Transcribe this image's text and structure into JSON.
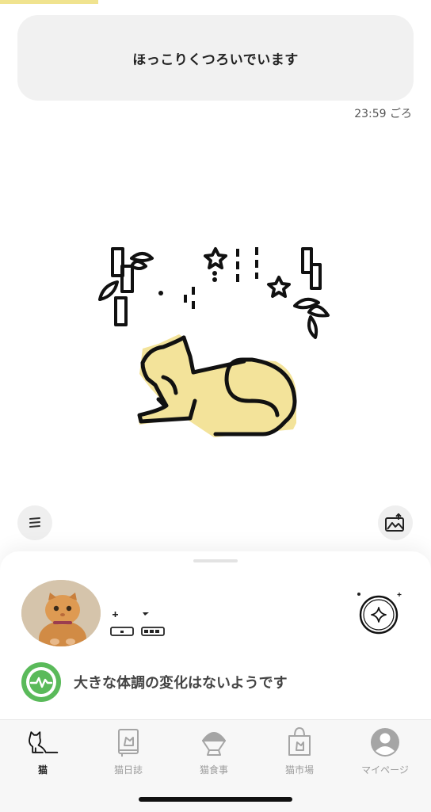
{
  "status": {
    "message": "ほっこりくつろいでいます",
    "time": "23:59 ごろ"
  },
  "scene": {
    "subject": "resting-cat-illustration",
    "accent_color": "#f3e39a"
  },
  "controls": {
    "menu_icon": "list-icon",
    "share_icon": "image-share-icon"
  },
  "cat_card": {
    "avatar": "cat-photo",
    "health_icon": "heartbeat-icon",
    "health_color": "#5aba5a",
    "health_status": "大きな体調の変化はないようです"
  },
  "tabs": [
    {
      "label": "猫",
      "icon": "cat-icon",
      "active": true
    },
    {
      "label": "猫日誌",
      "icon": "journal-icon",
      "active": false
    },
    {
      "label": "猫食事",
      "icon": "food-bowl-icon",
      "active": false
    },
    {
      "label": "猫市場",
      "icon": "shopping-bag-icon",
      "active": false
    },
    {
      "label": "マイページ",
      "icon": "user-icon",
      "active": false
    }
  ]
}
